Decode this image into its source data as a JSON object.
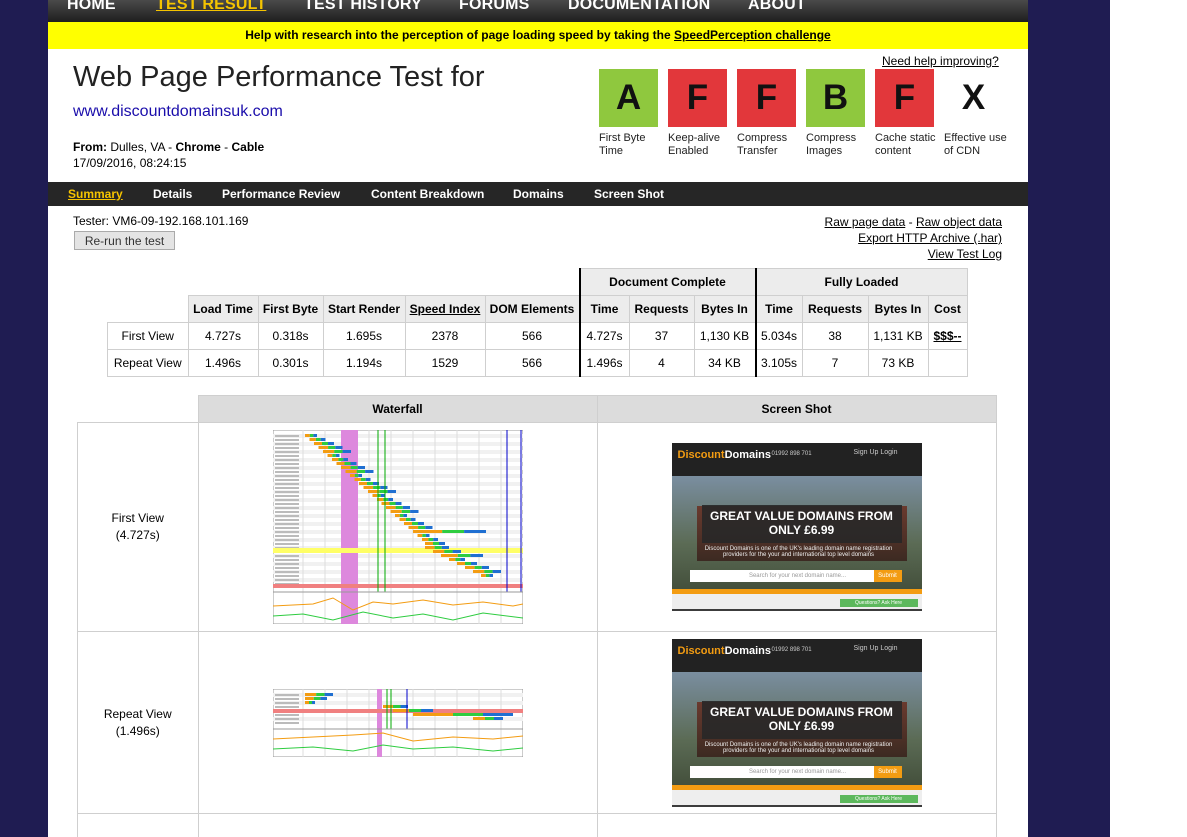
{
  "nav": {
    "items": [
      "HOME",
      "TEST RESULT",
      "TEST HISTORY",
      "FORUMS",
      "DOCUMENTATION",
      "ABOUT"
    ],
    "active": "TEST RESULT"
  },
  "banner": {
    "text": "Help with research into the perception of page loading speed by taking the",
    "link": "SpeedPerception challenge"
  },
  "header": {
    "title": "Web Page Performance Test for",
    "site": "www.discountdomainsuk.com",
    "from_label": "From:",
    "location": "Dulles, VA",
    "sep": " - ",
    "browser": "Chrome",
    "connection": "Cable",
    "datetime": "17/09/2016, 08:24:15",
    "help_link": "Need help improving?"
  },
  "grades": [
    {
      "letter": "A",
      "label": "First Byte Time",
      "color": "#8fc83e"
    },
    {
      "letter": "F",
      "label": "Keep-alive Enabled",
      "color": "#e2373b"
    },
    {
      "letter": "F",
      "label": "Compress Transfer",
      "color": "#e2373b"
    },
    {
      "letter": "B",
      "label": "Compress Images",
      "color": "#8fc83e"
    },
    {
      "letter": "F",
      "label": "Cache static content",
      "color": "#e2373b"
    },
    {
      "letter": "X",
      "label": "Effective use of CDN",
      "color": "#ffffff"
    }
  ],
  "subnav": {
    "items": [
      "Summary",
      "Details",
      "Performance Review",
      "Content Breakdown",
      "Domains",
      "Screen Shot"
    ],
    "active": "Summary"
  },
  "tester": "Tester: VM6-09-192.168.101.169",
  "rerun": "Re-run the test",
  "links": {
    "raw_page": "Raw page data",
    "dash": " - ",
    "raw_object": "Raw object data",
    "export": "Export HTTP Archive (.har)",
    "log": "View Test Log"
  },
  "results": {
    "group_doc": "Document Complete",
    "group_full": "Fully Loaded",
    "columns": [
      "Load Time",
      "First Byte",
      "Start Render",
      "Speed Index",
      "DOM Elements",
      "Time",
      "Requests",
      "Bytes In",
      "Time",
      "Requests",
      "Bytes In",
      "Cost"
    ],
    "rows": [
      {
        "label": "First View",
        "cells": [
          "4.727s",
          "0.318s",
          "1.695s",
          "2378",
          "566",
          "4.727s",
          "37",
          "1,130 KB",
          "5.034s",
          "38",
          "1,131 KB",
          "$$$--"
        ]
      },
      {
        "label": "Repeat View",
        "cells": [
          "1.496s",
          "0.301s",
          "1.194s",
          "1529",
          "566",
          "1.496s",
          "4",
          "34 KB",
          "3.105s",
          "7",
          "73 KB",
          ""
        ]
      }
    ]
  },
  "waterfall": {
    "col_waterfall": "Waterfall",
    "col_screenshot": "Screen Shot",
    "views": [
      {
        "label": "First View",
        "time": "(4.727s)"
      },
      {
        "label": "Repeat View",
        "time": "(1.496s)"
      }
    ]
  },
  "screenshot": {
    "logo_a": "Discount",
    "logo_b": "Domains",
    "phone": "01992 898 701",
    "signin": "Sign Up   Login",
    "headline_1": "GREAT VALUE DOMAINS FROM",
    "headline_2": "ONLY £6.99",
    "desc": "Discount Domains is one of the UK's leading domain name registration providers for the your and international top level domains",
    "search_placeholder": "Search for your next domain name...",
    "submit": "Submit",
    "question": "Questions? Ask Here"
  },
  "colors": {
    "accent": "#f5c400",
    "banner": "#ffff00",
    "grade_good": "#8fc83e",
    "grade_bad": "#e2373b"
  }
}
